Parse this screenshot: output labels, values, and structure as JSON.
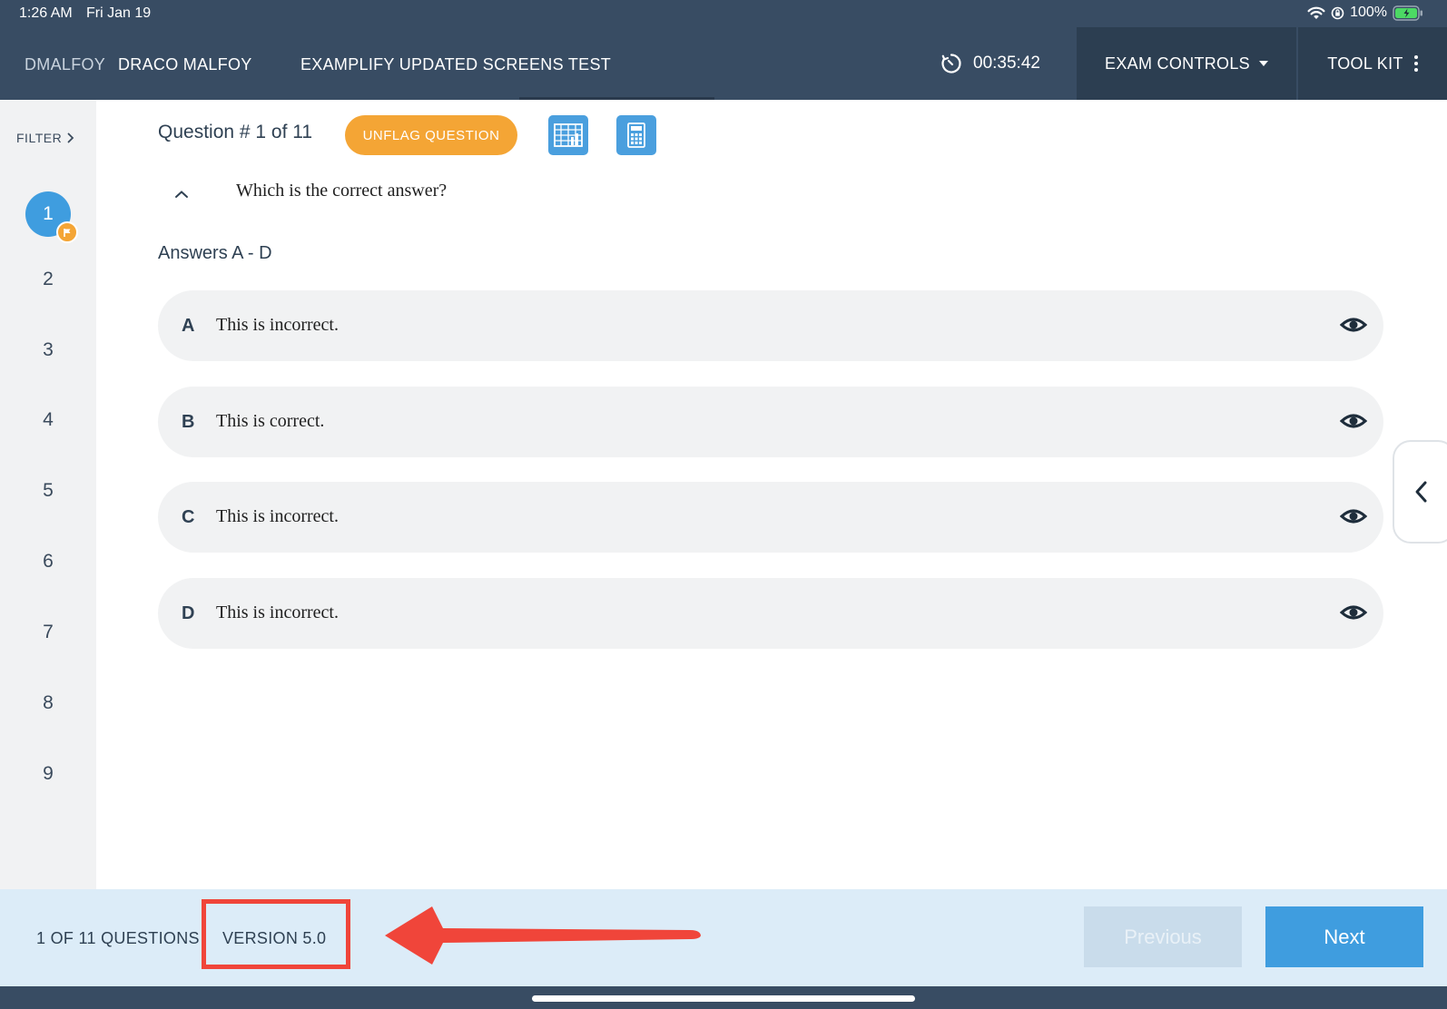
{
  "status_bar": {
    "time": "1:26 AM",
    "date": "Fri Jan 19",
    "battery": "100%"
  },
  "header": {
    "username": "DMALFOY",
    "full_name": "DRACO MALFOY",
    "exam_title": "EXAMPLIFY UPDATED SCREENS TEST",
    "timer": "00:35:42",
    "exam_controls_label": "EXAM CONTROLS",
    "tool_kit_label": "TOOL KIT"
  },
  "sidebar": {
    "filter_label": "FILTER",
    "questions": [
      "1",
      "2",
      "3",
      "4",
      "5",
      "6",
      "7",
      "8",
      "9"
    ],
    "active_question": "1"
  },
  "main": {
    "question_header": "Question # 1 of 11",
    "unflag_label": "UNFLAG QUESTION",
    "prompt": "Which is the correct answer?",
    "answers_title": "Answers A - D",
    "answers": [
      {
        "letter": "A",
        "text": "This is incorrect."
      },
      {
        "letter": "B",
        "text": "This is correct."
      },
      {
        "letter": "C",
        "text": "This is incorrect."
      },
      {
        "letter": "D",
        "text": "This is incorrect."
      }
    ]
  },
  "footer": {
    "count": "1 OF 11 QUESTIONS",
    "version": "VERSION 5.0",
    "previous_label": "Previous",
    "next_label": "Next"
  },
  "colors": {
    "header_bg": "#384c63",
    "accent_blue": "#3f9ddf",
    "flag_orange": "#f4a535",
    "highlight_red": "#f0453a"
  }
}
